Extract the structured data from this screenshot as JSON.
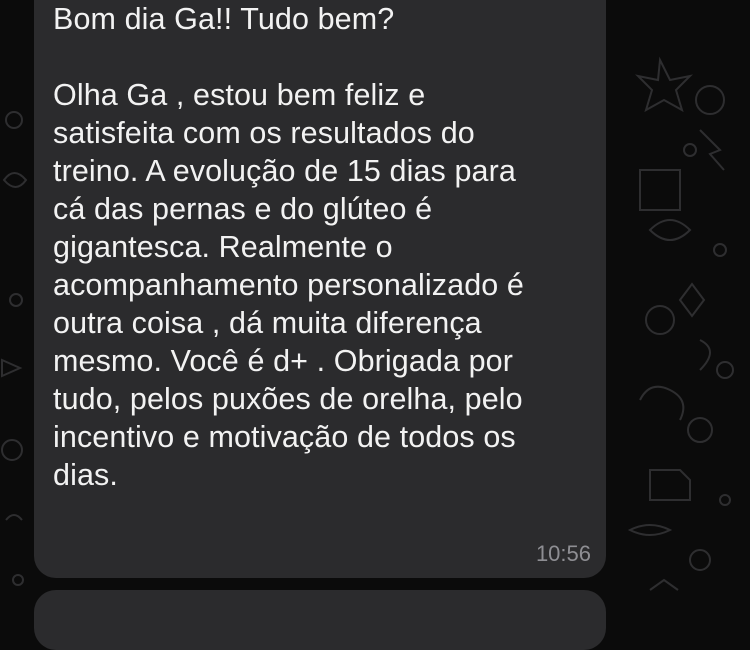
{
  "chat": {
    "message": {
      "text": "Bom dia Ga!! Tudo bem?\n\nOlha Ga , estou bem feliz e\nsatisfeita com os resultados do\ntreino. A evolução de 15 dias para\ncá das pernas e do glúteo é\ngigantesca. Realmente o\nacompanhamento personalizado é\noutra coisa , dá muita diferença\nmesmo. Você é d+ . Obrigada por\ntudo, pelos puxões de orelha, pelo\nincentivo e motivação de todos os\ndias.",
      "time": "10:56"
    }
  },
  "colors": {
    "background": "#0b0b0b",
    "bubble": "#2b2b2d",
    "text": "#f2f2f2",
    "timestamp": "#8e8e93"
  }
}
